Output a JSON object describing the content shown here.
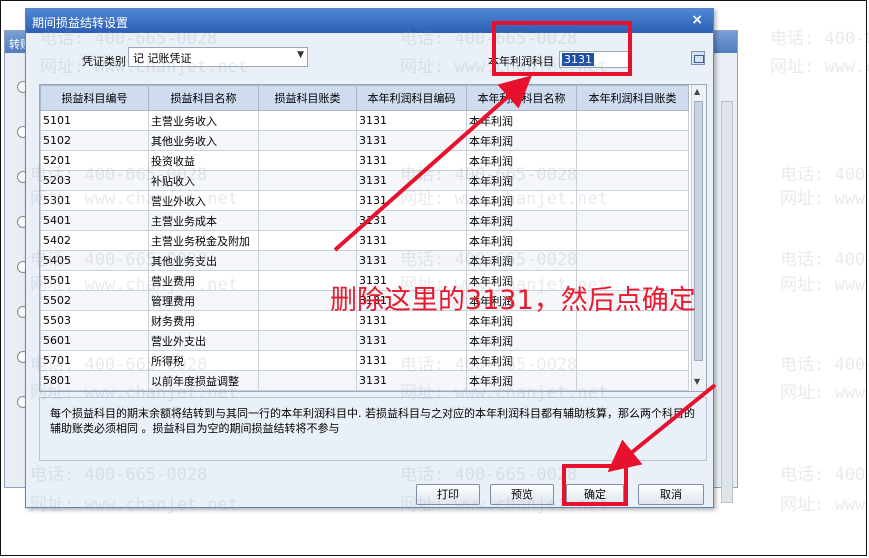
{
  "background_window": {
    "title": "转账"
  },
  "dialog": {
    "title": "期间损益结转设置",
    "close_glyph": "×"
  },
  "voucher": {
    "label": "凭证类别",
    "value": "记 记账凭证"
  },
  "profit_account": {
    "label": "本年利润科目",
    "value": "3131"
  },
  "table": {
    "headers": [
      "损益科目编号",
      "损益科目名称",
      "损益科目账类",
      "本年利润科目编码",
      "本年利润科目名称",
      "本年利润科目账类"
    ],
    "rows": [
      [
        "5101",
        "主营业务收入",
        "",
        "3131",
        "本年利润",
        ""
      ],
      [
        "5102",
        "其他业务收入",
        "",
        "3131",
        "本年利润",
        ""
      ],
      [
        "5201",
        "投资收益",
        "",
        "3131",
        "本年利润",
        ""
      ],
      [
        "5203",
        "补贴收入",
        "",
        "3131",
        "本年利润",
        ""
      ],
      [
        "5301",
        "营业外收入",
        "",
        "3131",
        "本年利润",
        ""
      ],
      [
        "5401",
        "主营业务成本",
        "",
        "3131",
        "本年利润",
        ""
      ],
      [
        "5402",
        "主营业务税金及附加",
        "",
        "3131",
        "本年利润",
        ""
      ],
      [
        "5405",
        "其他业务支出",
        "",
        "3131",
        "本年利润",
        ""
      ],
      [
        "5501",
        "营业费用",
        "",
        "3131",
        "本年利润",
        ""
      ],
      [
        "5502",
        "管理费用",
        "",
        "3131",
        "本年利润",
        ""
      ],
      [
        "5503",
        "财务费用",
        "",
        "3131",
        "本年利润",
        ""
      ],
      [
        "5601",
        "营业外支出",
        "",
        "3131",
        "本年利润",
        ""
      ],
      [
        "5701",
        "所得税",
        "",
        "3131",
        "本年利润",
        ""
      ],
      [
        "5801",
        "以前年度损益调整",
        "",
        "3131",
        "本年利润",
        ""
      ]
    ]
  },
  "note": "每个损益科目的期末余额将结转到与其同一行的本年利润科目中. 若损益科目与之对应的本年利润科目都有辅助核算，那么两个科目的辅助账类必须相同  。损益科目为空的期间损益结转将不参与",
  "buttons": {
    "print": "打印",
    "preview": "预览",
    "ok": "确定",
    "cancel": "取消"
  },
  "annotation": {
    "text": "删除这里的3131，然后点确定",
    "color": "#e8112d"
  },
  "watermarks": {
    "phone": "电话: 400-665-0028",
    "site": "网址: www.chanjet.net"
  }
}
